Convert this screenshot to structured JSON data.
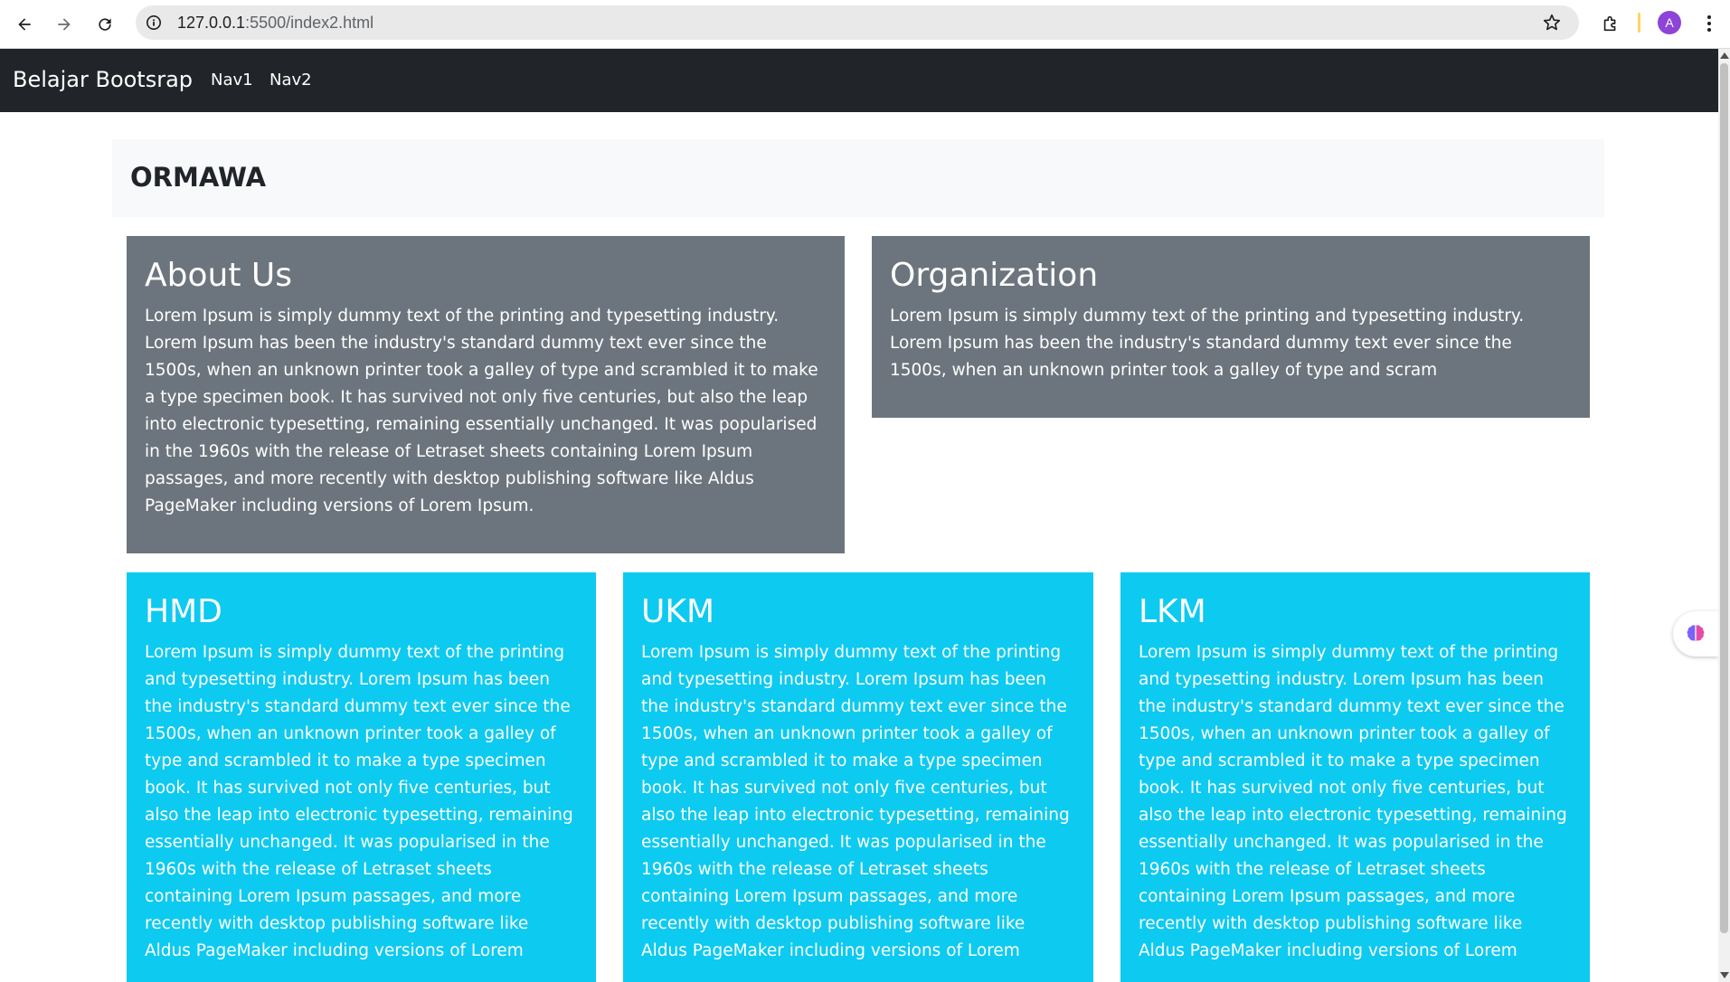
{
  "browser": {
    "url_host": "127.0.0.1",
    "url_path": ":5500/index2.html",
    "avatar_letter": "A",
    "accent": "#8e44d6"
  },
  "navbar": {
    "brand": "Belajar Bootsrap",
    "links": [
      "Nav1",
      "Nav2"
    ],
    "bg": "#212529"
  },
  "header": {
    "title": "ORMAWA"
  },
  "cards": {
    "about": {
      "title": "About Us",
      "text": "Lorem Ipsum is simply dummy text of the printing and typesetting industry. Lorem Ipsum has been the industry's standard dummy text ever since the 1500s, when an unknown printer took a galley of type and scrambled it to make a type specimen book. It has survived not only five centuries, but also the leap into electronic typesetting, remaining essentially unchanged. It was popularised in the 1960s with the release of Letraset sheets containing Lorem Ipsum passages, and more recently with desktop publishing software like Aldus PageMaker including versions of Lorem Ipsum."
    },
    "organization": {
      "title": "Organization",
      "text": "Lorem Ipsum is simply dummy text of the printing and typesetting industry. Lorem Ipsum has been the industry's standard dummy text ever since the 1500s, when an unknown printer took a galley of type and scram"
    },
    "hmd": {
      "title": "HMD",
      "text": "Lorem Ipsum is simply dummy text of the printing and typesetting industry. Lorem Ipsum has been the industry's standard dummy text ever since the 1500s, when an unknown printer took a galley of type and scrambled it to make a type specimen book. It has survived not only five centuries, but also the leap into electronic typesetting, remaining essentially unchanged. It was popularised in the 1960s with the release of Letraset sheets containing Lorem Ipsum passages, and more recently with desktop publishing software like Aldus PageMaker including versions of Lorem"
    },
    "ukm": {
      "title": "UKM",
      "text": "Lorem Ipsum is simply dummy text of the printing and typesetting industry. Lorem Ipsum has been the industry's standard dummy text ever since the 1500s, when an unknown printer took a galley of type and scrambled it to make a type specimen book. It has survived not only five centuries, but also the leap into electronic typesetting, remaining essentially unchanged. It was popularised in the 1960s with the release of Letraset sheets containing Lorem Ipsum passages, and more recently with desktop publishing software like Aldus PageMaker including versions of Lorem"
    },
    "lkm": {
      "title": "LKM",
      "text": "Lorem Ipsum is simply dummy text of the printing and typesetting industry. Lorem Ipsum has been the industry's standard dummy text ever since the 1500s, when an unknown printer took a galley of type and scrambled it to make a type specimen book. It has survived not only five centuries, but also the leap into electronic typesetting, remaining essentially unchanged. It was popularised in the 1960s with the release of Letraset sheets containing Lorem Ipsum passages, and more recently with desktop publishing software like Aldus PageMaker including versions of Lorem"
    }
  },
  "colors": {
    "gray_card": "#6c757d",
    "cyan_card": "#0dcaf0",
    "header_bg": "#f8f9fa"
  },
  "icons": [
    "back-arrow-icon",
    "forward-arrow-icon",
    "reload-icon",
    "site-info-icon",
    "bookmark-star-icon",
    "extensions-puzzle-icon",
    "kebab-menu-icon",
    "brain-widget-icon"
  ]
}
